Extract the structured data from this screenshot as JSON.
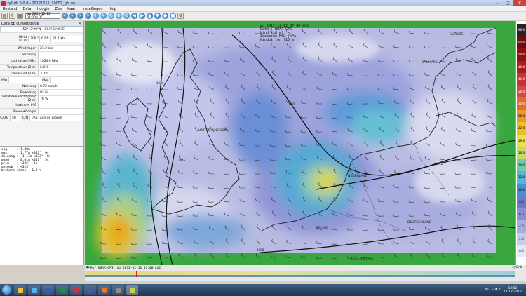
{
  "window": {
    "title": "zyGrib 6.0.0 - 20121211_1005Z_gfs.no",
    "colors": {
      "titlebar": "#b6cbe7",
      "close": "#c9473a"
    }
  },
  "menu": [
    "Bestand",
    "Data",
    "Hoogte",
    "Zee",
    "Kaart",
    "Instellingen",
    "Help"
  ],
  "toolbar": {
    "date_value": "wo 2012-12-12 07:00 LOC"
  },
  "panel": {
    "title": "Data op cursorpositie",
    "coords": [
      "52°17'00\"N",
      "004°55'05\"E"
    ],
    "wind": {
      "label": "Wind\n10 m",
      "dir": "308 °",
      "beaufort": "6 Bft",
      "speed": "21.1 kts"
    },
    "rows": [
      {
        "label": "Windvlagen",
        "value": "23.2 kts"
      },
      {
        "label": "Stroming",
        "value": ""
      },
      {
        "label": "Luchtdruk (MSL)",
        "value": "1020.9 hPa"
      },
      {
        "label": "Temperatuur (2 m)",
        "value": "6.6°C"
      },
      {
        "label": "Dauwpunt (2 m)",
        "value": "3.0°C"
      }
    ],
    "minmax": {
      "min_label": "Min",
      "max_label": "Max"
    },
    "rows2": [
      {
        "label": "Neerslag",
        "value": "0.72 mm/h"
      },
      {
        "label": "Bewolking",
        "value": "93 %"
      },
      {
        "label": "Relatieve vochtigheid (2 m)",
        "value": "78 %"
      },
      {
        "label": "Isotherm 0°C",
        "value": ""
      },
      {
        "label": "Sneeuwhoogte",
        "value": ""
      }
    ],
    "cape": {
      "cape_label": "CAPE",
      "cape_value": "50",
      "cin_label": "CIN",
      "cin_value": "J/Kg (aan de grond)"
    },
    "info_text": "sig     : 1.40m\nmax     : 1.77m <343°  6s\ndeining :  1.17m <333°  8s\nwind    : 0.01m <311°  5s\nprim    : <325°  5s\ngecomb  : <325°\nbrekers (kans): 1.2 %"
  },
  "map": {
    "header": [
      "wo 2012-12-12 07:00 LOC",
      "Data : NOAA-GFS",
      "Wind (10 m)",
      "Isobaren MSL (hPa)",
      "Windpijlen (10 m)"
    ],
    "labels": [
      {
        "text": "UNITED KINGDOM"
      },
      {
        "text": "NEDERLAND"
      },
      {
        "text": "DEUTSCHLAND"
      },
      {
        "text": "BELGIE"
      },
      {
        "text": "LUXEMBOURG"
      },
      {
        "text": "DANMARK"
      },
      {
        "text": "SVERIGE"
      }
    ],
    "isobar_labels": [
      "1024",
      "1016",
      "1020",
      "1012",
      "1008"
    ],
    "colors": {
      "land": "#3aa63f",
      "low_wind": "#e2e2f0",
      "mid_wind": "#9999d4",
      "blue_wind": "#4a8fd6",
      "cyan": "#5bc2d8",
      "yellow": "#e6c42a",
      "orange": "#e79a1a"
    }
  },
  "scale": {
    "values": [
      "66.0",
      "60.0",
      "54.0",
      "48.0",
      "42.0",
      "36.0",
      "30.0",
      "26.0",
      "22.0",
      "19.0",
      "16.0",
      "14.0",
      "12.0",
      "10.0",
      "8.0",
      "6.0",
      "4.0",
      "2.0",
      "0.0"
    ],
    "colors": [
      "#222222",
      "#6a0d0d",
      "#8b1010",
      "#a61f1f",
      "#c43434",
      "#d44848",
      "#df6b2f",
      "#e99a26",
      "#eebf23",
      "#e8e04a",
      "#c0dd60",
      "#73c8a8",
      "#58b5d4",
      "#4a8fd6",
      "#6b7ac9",
      "#8b8fd0",
      "#a7aedd",
      "#c7cce8",
      "#e6e8f3"
    ],
    "unit": "kts"
  },
  "timebar": {
    "label": "Ref NOAA-GFS: di 2012-12-11 07:00 LOC",
    "brand": "zyGrib"
  },
  "taskbar": {
    "time": "13:02",
    "date": "11-12-2012",
    "lang": "NL"
  }
}
